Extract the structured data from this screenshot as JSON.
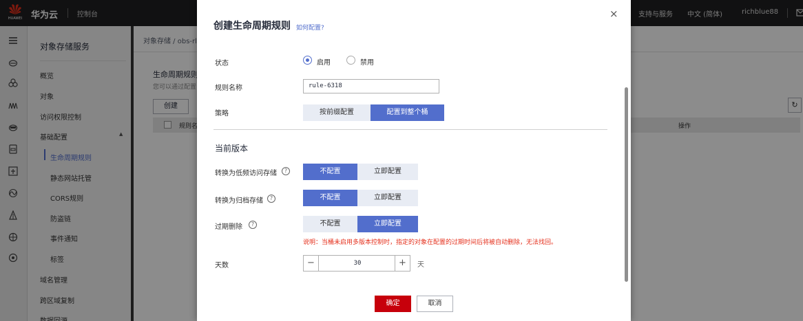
{
  "topbar": {
    "brand_en": "HUAWEI",
    "brand_cn": "华为云",
    "console": "控制台",
    "support": "支持与服务",
    "language": "中文 (简体)",
    "user": "richblue88"
  },
  "service_nav": {
    "title": "对象存储服务",
    "items": {
      "overview": "概览",
      "objects": "对象",
      "access": "访问权限控制",
      "basic": "基础配置",
      "domain": "域名管理",
      "replication": "跨区域复制",
      "backsource": "数据回源"
    },
    "sub_items": {
      "lifecycle": "生命周期规则",
      "static_site": "静态网站托管",
      "cors": "CORS规则",
      "hotlink": "防盗链",
      "event": "事件通知",
      "tags": "标签"
    }
  },
  "content": {
    "breadcrumb": "对象存储 / obs-rle",
    "page_title": "生命周期规则",
    "page_desc": "您可以通过配置",
    "create_label": "创建",
    "col_rule": "规则名",
    "col_action": "操作"
  },
  "dialog": {
    "title": "创建生命周期规则",
    "help_link": "如何配置?",
    "status_label": "状态",
    "status_enabled": "启用",
    "status_disabled": "禁用",
    "name_label": "规则名称",
    "name_value": "rule-6318",
    "policy_label": "策略",
    "policy_by_prefix": "按前缀配置",
    "policy_whole_bucket": "配置到整个桶",
    "section_title": "当前版本",
    "transition_ia_label": "转换为低频访问存储",
    "transition_archive_label": "转换为归档存储",
    "expiration_label": "过期删除",
    "not_config": "不配置",
    "config_now": "立即配置",
    "note": "说明：当桶未启用多版本控制时，指定的对象在配置的过期时间后将被自动删除，无法找回。",
    "days_label": "天数",
    "days_value": "30",
    "days_unit": "天",
    "ok_label": "确定",
    "cancel_label": "取消"
  },
  "colors": {
    "accent": "#526ecc",
    "primary_button": "#c7000b",
    "note_text": "#e5301c",
    "topbar": "#1f1f21"
  }
}
